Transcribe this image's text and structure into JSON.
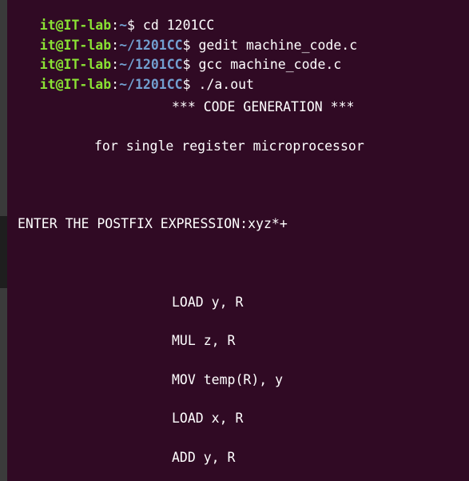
{
  "prompt": {
    "user_host": "it@IT-lab",
    "sep": ":",
    "home_path": "~",
    "dir_path": "~/1201CC",
    "symbol": "$"
  },
  "commands": [
    "cd 1201CC",
    "gedit machine_code.c",
    "gcc machine_code.c",
    "./a.out"
  ],
  "output": {
    "header": "*** CODE GENERATION ***",
    "subheader": "for single register microprocessor",
    "enter_line": "ENTER THE POSTFIX EXPRESSION:xyz*+",
    "code_lines": [
      "LOAD y, R",
      "MUL z, R",
      "MOV temp(R), y",
      "LOAD x, R",
      "ADD y, R"
    ]
  }
}
